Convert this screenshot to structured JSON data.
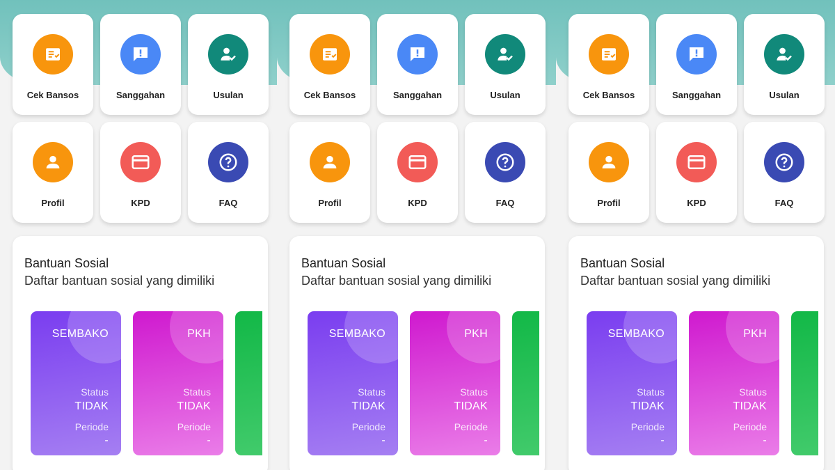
{
  "screens": [
    {
      "menu": [
        {
          "label": "Cek Bansos",
          "icon": "checklist-icon",
          "color": "#f8950d"
        },
        {
          "label": "Sanggahan",
          "icon": "feedback-icon",
          "color": "#4a88f6"
        },
        {
          "label": "Usulan",
          "icon": "user-check-icon",
          "color": "#11897a"
        },
        {
          "label": "Profil",
          "icon": "person-icon",
          "color": "#f8950d"
        },
        {
          "label": "KPD",
          "icon": "credit-card-icon",
          "color": "#f25b57"
        },
        {
          "label": "FAQ",
          "icon": "help-icon",
          "color": "#3a4ab3"
        }
      ],
      "bansos": {
        "title": "Bantuan Sosial",
        "subtitle": "Daftar bantuan sosial yang dimiliki",
        "programs": [
          {
            "name": "SEMBAKO",
            "status_label": "Status",
            "status": "TIDAK",
            "periode_label": "Periode",
            "periode": "-"
          },
          {
            "name": "PKH",
            "status_label": "Status",
            "status": "TIDAK",
            "periode_label": "Periode",
            "periode": "-"
          }
        ]
      }
    },
    {
      "menu": [
        {
          "label": "Cek Bansos",
          "icon": "checklist-icon",
          "color": "#f8950d"
        },
        {
          "label": "Sanggahan",
          "icon": "feedback-icon",
          "color": "#4a88f6"
        },
        {
          "label": "Usulan",
          "icon": "user-check-icon",
          "color": "#11897a"
        },
        {
          "label": "Profil",
          "icon": "person-icon",
          "color": "#f8950d"
        },
        {
          "label": "KPD",
          "icon": "credit-card-icon",
          "color": "#f25b57"
        },
        {
          "label": "FAQ",
          "icon": "help-icon",
          "color": "#3a4ab3"
        }
      ],
      "bansos": {
        "title": "Bantuan Sosial",
        "subtitle": "Daftar bantuan sosial yang dimiliki",
        "programs": [
          {
            "name": "SEMBAKO",
            "status_label": "Status",
            "status": "TIDAK",
            "periode_label": "Periode",
            "periode": "-"
          },
          {
            "name": "PKH",
            "status_label": "Status",
            "status": "TIDAK",
            "periode_label": "Periode",
            "periode": "-"
          }
        ]
      }
    },
    {
      "menu": [
        {
          "label": "Cek Bansos",
          "icon": "checklist-icon",
          "color": "#f8950d"
        },
        {
          "label": "Sanggahan",
          "icon": "feedback-icon",
          "color": "#4a88f6"
        },
        {
          "label": "Usulan",
          "icon": "user-check-icon",
          "color": "#11897a"
        },
        {
          "label": "Profil",
          "icon": "person-icon",
          "color": "#f8950d"
        },
        {
          "label": "KPD",
          "icon": "credit-card-icon",
          "color": "#f25b57"
        },
        {
          "label": "FAQ",
          "icon": "help-icon",
          "color": "#3a4ab3"
        }
      ],
      "bansos": {
        "title": "Bantuan Sosial",
        "subtitle": "Daftar bantuan sosial yang dimiliki",
        "programs": [
          {
            "name": "SEMBAKO",
            "status_label": "Status",
            "status": "TIDAK",
            "periode_label": "Periode",
            "periode": "-"
          },
          {
            "name": "PKH",
            "status_label": "Status",
            "status": "TIDAK",
            "periode_label": "Periode",
            "periode": "-"
          }
        ]
      }
    }
  ],
  "program_gradients": {
    "sembako": [
      "#7a3df0",
      "#a57ff2"
    ],
    "pkh": [
      "#cf19cf",
      "#ea7de8"
    ],
    "third": [
      "#12b847",
      "#45cc6e"
    ]
  }
}
